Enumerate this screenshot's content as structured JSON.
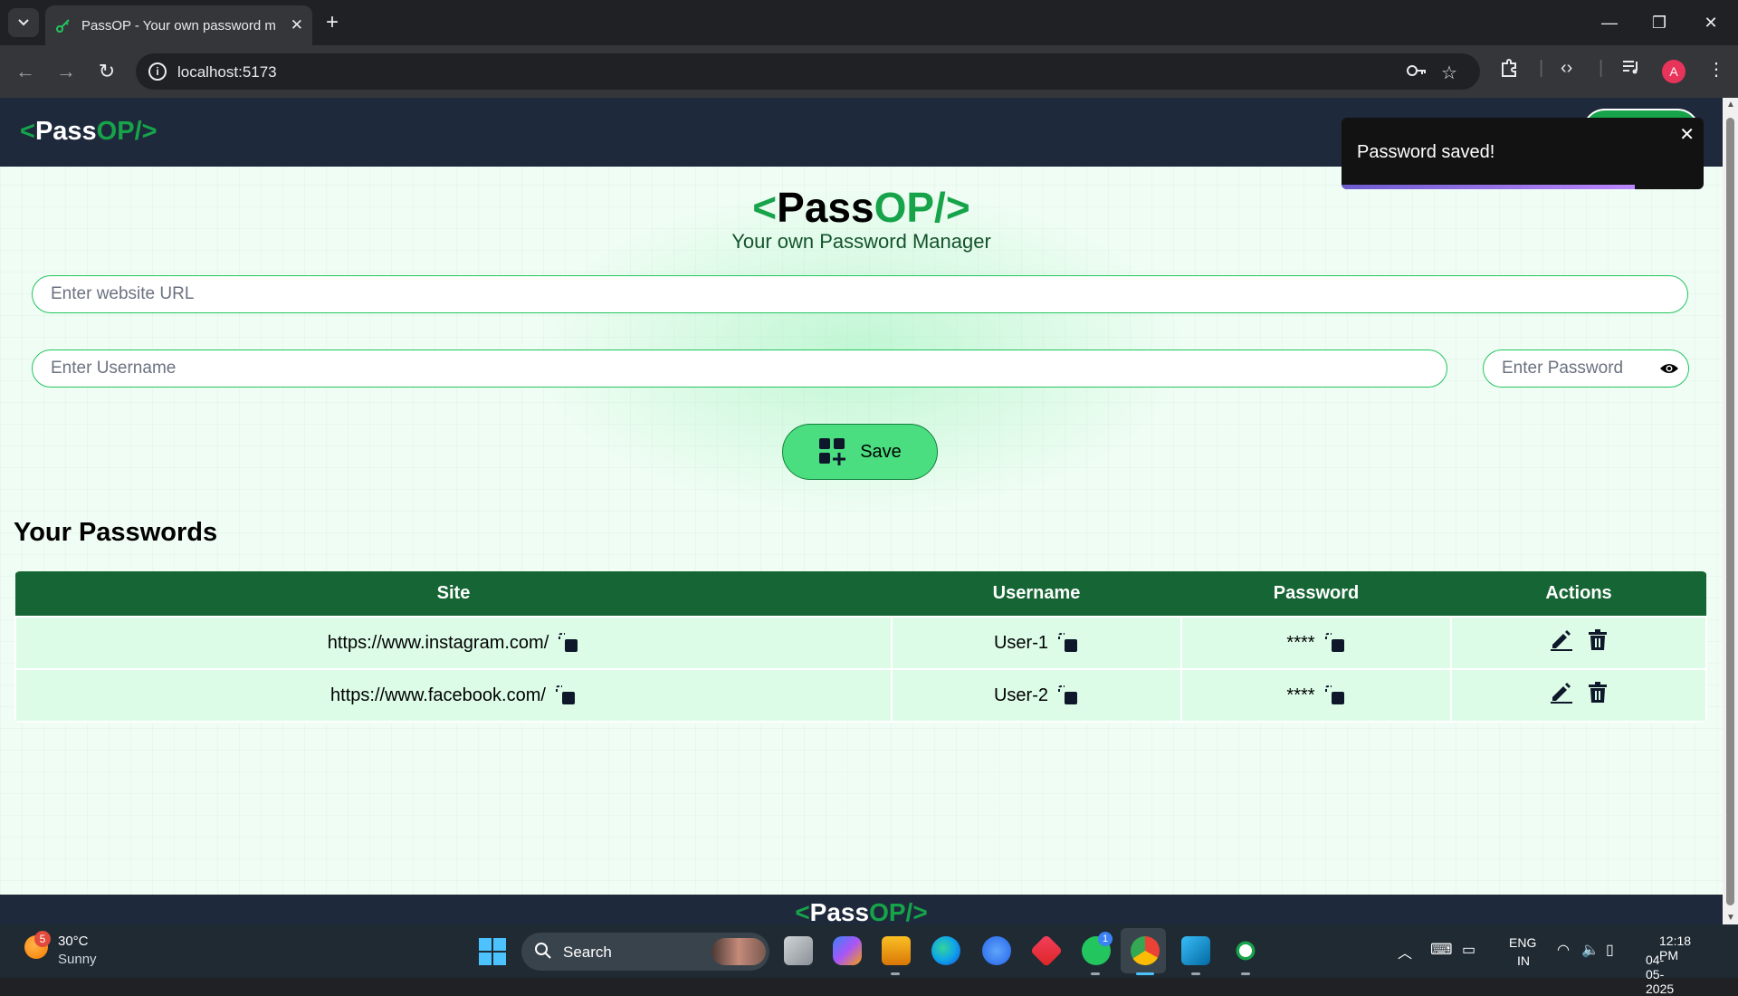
{
  "browser": {
    "tab_title": "PassOP - Your own password m",
    "url": "localhost:5173",
    "profile_initial": "A"
  },
  "app": {
    "logo": {
      "open": "<",
      "pass": "Pass",
      "op": "OP/",
      "close": ">"
    },
    "tagline": "Your own Password Manager",
    "form": {
      "url_placeholder": "Enter website URL",
      "username_placeholder": "Enter Username",
      "password_placeholder": "Enter Password",
      "save_label": "Save"
    },
    "passwords_heading": "Your Passwords",
    "table": {
      "headers": [
        "Site",
        "Username",
        "Password",
        "Actions"
      ],
      "rows": [
        {
          "site": "https://www.instagram.com/",
          "username": "User-1",
          "password": "****"
        },
        {
          "site": "https://www.facebook.com/",
          "username": "User-2",
          "password": "****"
        }
      ]
    },
    "toast": {
      "message": "Password saved!",
      "progress": 0.81
    }
  },
  "taskbar": {
    "weather_badge": "5",
    "temperature": "30°C",
    "condition": "Sunny",
    "search_label": "Search",
    "whatsapp_badge": "1",
    "lang_1": "ENG",
    "lang_2": "IN",
    "time": "12:18 PM",
    "date": "04-05-2025"
  },
  "colors": {
    "navbar": "#1e293b",
    "accent_green": "#16a34a",
    "table_header": "#166534",
    "table_row": "#dcfce7",
    "save_button": "#4ade80"
  }
}
